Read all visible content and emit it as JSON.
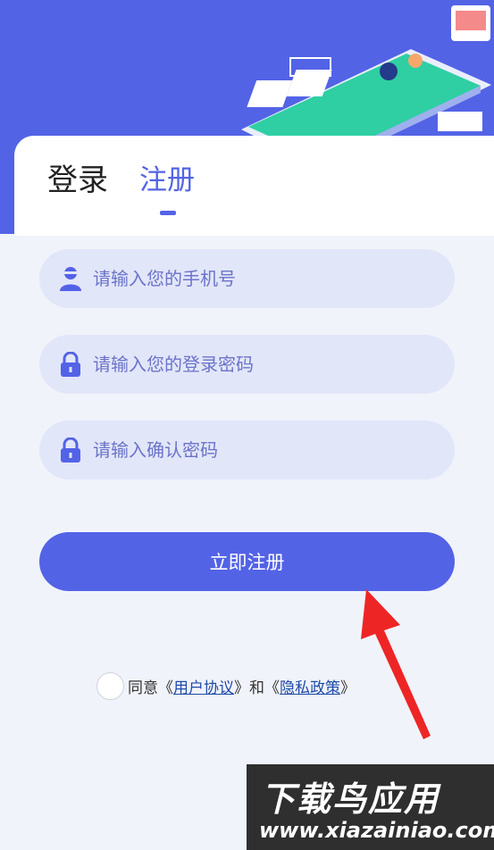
{
  "tabs": {
    "login_label": "登录",
    "register_label": "注册",
    "active": "register"
  },
  "form": {
    "phone_placeholder": "请输入您的手机号",
    "password_placeholder": "请输入您的登录密码",
    "confirm_placeholder": "请输入确认密码",
    "submit_label": "立即注册"
  },
  "agreement": {
    "checked": false,
    "prefix": "同意《",
    "user_agreement": "用户协议",
    "middle": "》和《",
    "privacy_policy": "隐私政策",
    "suffix": "》"
  },
  "watermark": {
    "title": "下载鸟应用",
    "url": "www.xiazainiao.com"
  },
  "colors": {
    "primary": "#5363e6",
    "field_bg": "#e2e6f9",
    "page_bg": "#f1f3fa",
    "arrow": "#ee2525",
    "link": "#1e4aa8"
  },
  "icons": {
    "phone_field": "user-icon",
    "password_field": "lock-icon",
    "confirm_field": "lock-icon"
  }
}
